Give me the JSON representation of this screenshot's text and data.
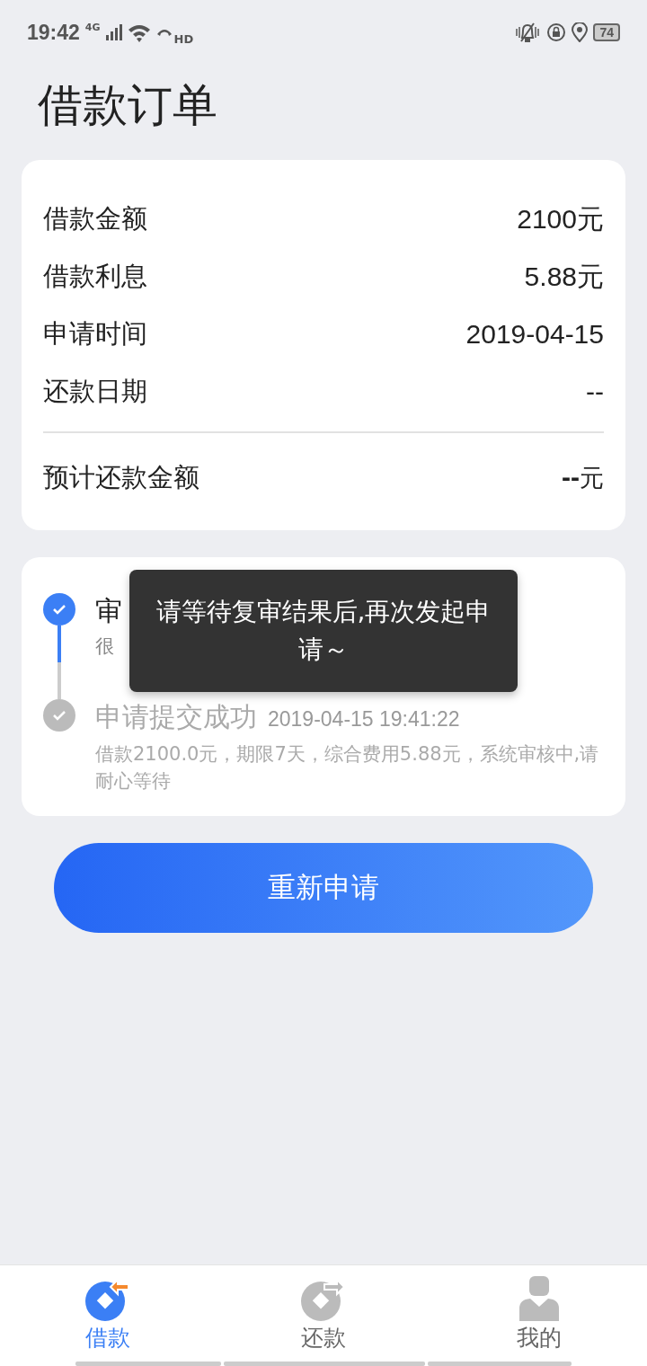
{
  "status_bar": {
    "time": "19:42",
    "network": "4G",
    "call_label": "HD",
    "battery": "74"
  },
  "page_title": "借款订单",
  "summary": {
    "rows": [
      {
        "label": "借款金额",
        "value": "2100元"
      },
      {
        "label": "借款利息",
        "value": "5.88元"
      },
      {
        "label": "申请时间",
        "value": "2019-04-15"
      },
      {
        "label": "还款日期",
        "value": "--"
      }
    ],
    "total": {
      "label": "预计还款金额",
      "value": "--",
      "unit": "元"
    }
  },
  "timeline": [
    {
      "title": "审",
      "desc": "很",
      "active": true
    },
    {
      "title": "申请提交成功",
      "time": "2019-04-15 19:41:22",
      "desc": "借款2100.0元，期限7天，综合费用5.88元，系统审核中,请耐心等待",
      "active": false
    }
  ],
  "toast": "请等待复审结果后,再次发起申请～",
  "reapply_button": "重新申请",
  "tabs": [
    {
      "label": "借款",
      "kind": "borrow",
      "selected": true
    },
    {
      "label": "还款",
      "kind": "repay",
      "selected": false
    },
    {
      "label": "我的",
      "kind": "profile",
      "selected": false
    }
  ]
}
